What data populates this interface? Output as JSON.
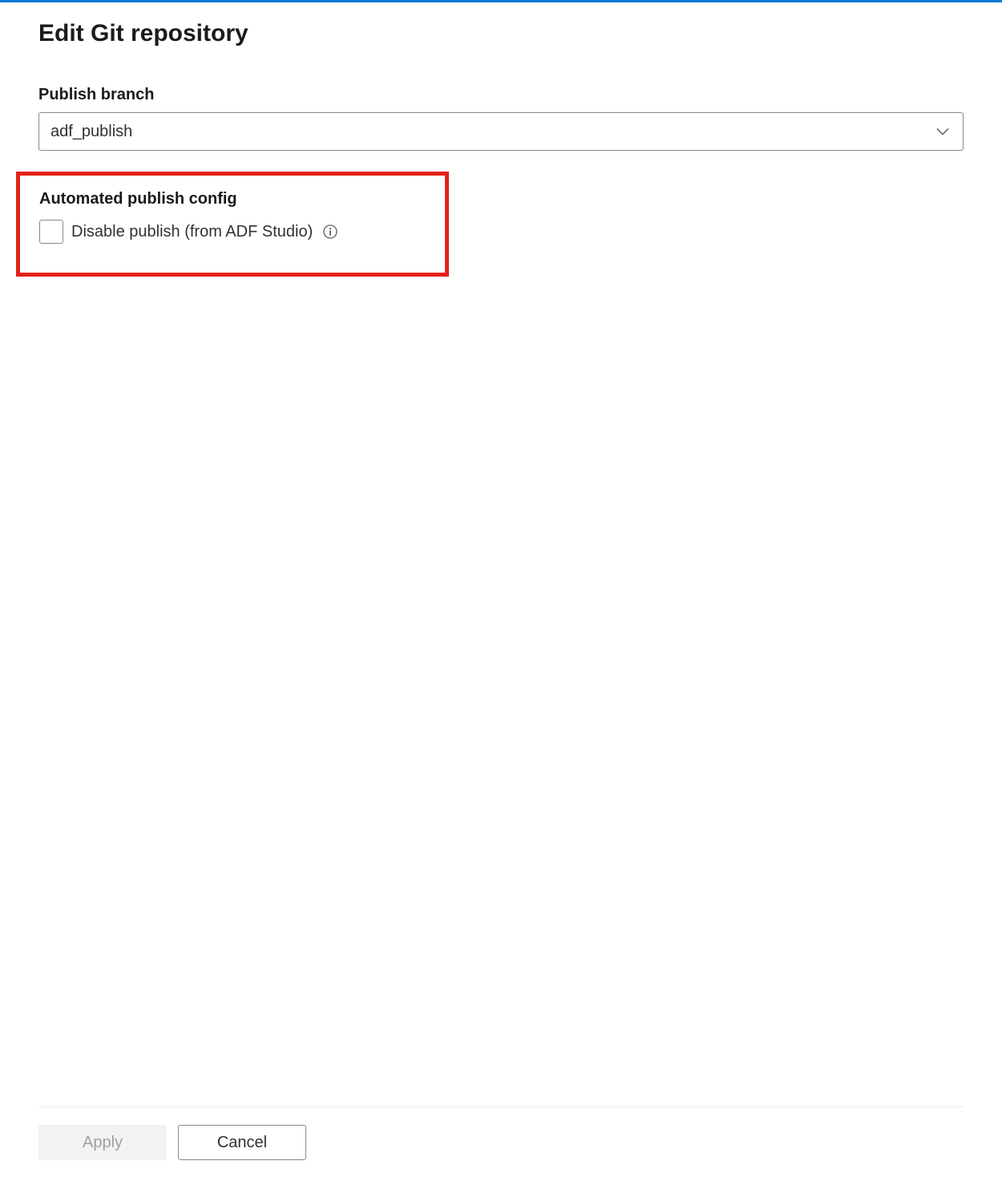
{
  "header": {
    "title": "Edit Git repository"
  },
  "publishBranch": {
    "label": "Publish branch",
    "value": "adf_publish"
  },
  "automatedPublish": {
    "sectionLabel": "Automated publish config",
    "checkboxLabel": "Disable publish (from ADF Studio)",
    "checked": false
  },
  "footer": {
    "applyLabel": "Apply",
    "cancelLabel": "Cancel"
  }
}
